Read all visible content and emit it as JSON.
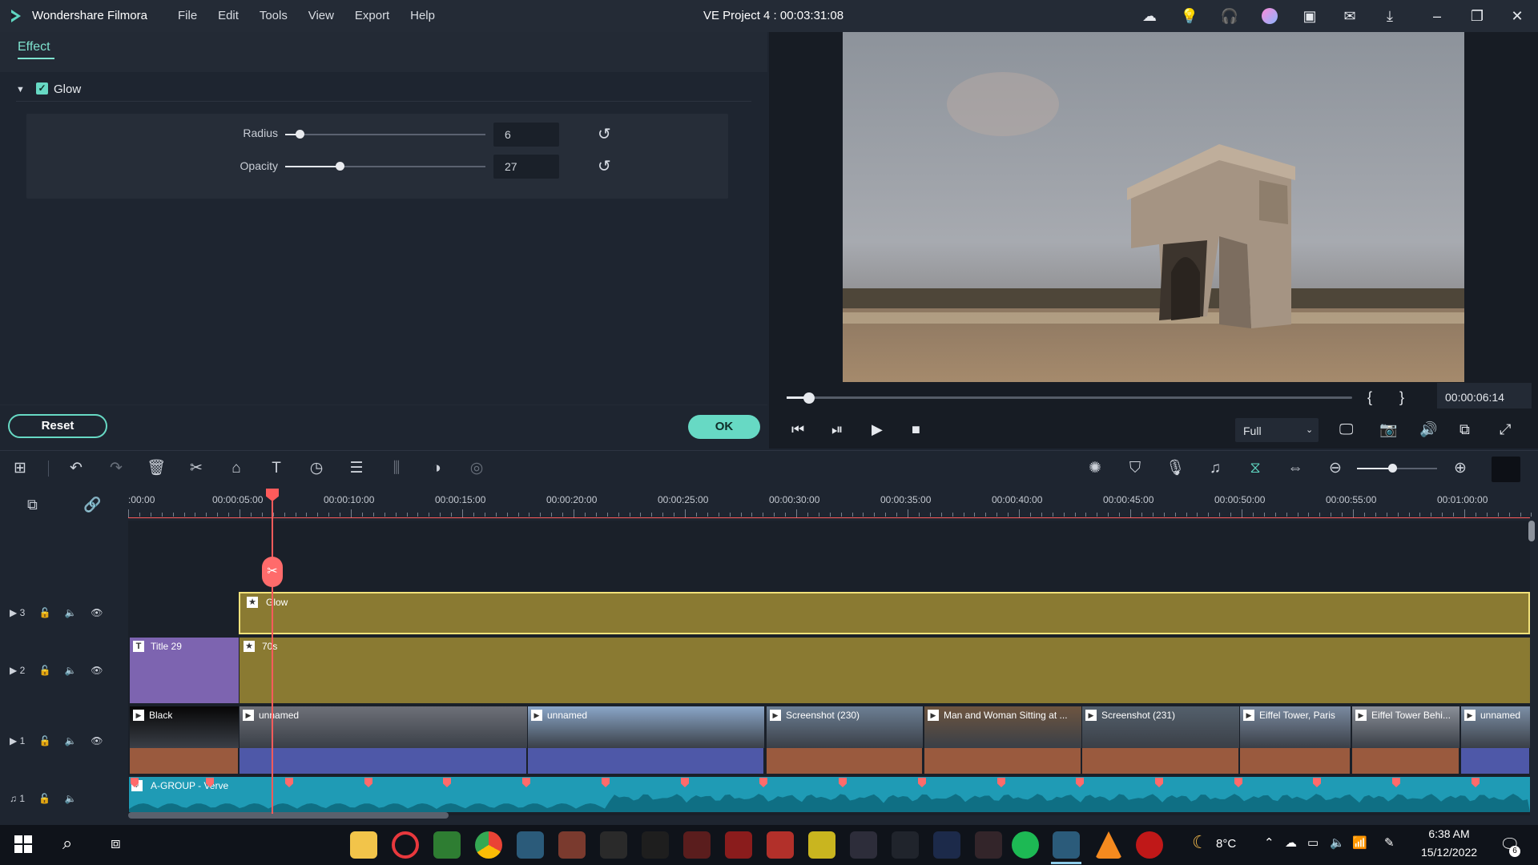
{
  "app": {
    "name": "Wondershare Filmora",
    "menu": [
      "File",
      "Edit",
      "Tools",
      "View",
      "Export",
      "Help"
    ],
    "project_title": "VE Project 4 : 00:03:31:08"
  },
  "effect_panel": {
    "tab": "Effect",
    "section": "Glow",
    "params": [
      {
        "label": "Radius",
        "value": "6",
        "fraction": 0.07
      },
      {
        "label": "Opacity",
        "value": "27",
        "fraction": 0.27
      }
    ],
    "reset_label": "Reset",
    "ok_label": "OK"
  },
  "preview": {
    "progress_fraction": 0.04,
    "mark_in": "{",
    "mark_out": "}",
    "time": "00:00:06:14",
    "quality": "Full"
  },
  "timeline": {
    "ruler": [
      ":00:00",
      "00:00:05:00",
      "00:00:10:00",
      "00:00:15:00",
      "00:00:20:00",
      "00:00:25:00",
      "00:00:30:00",
      "00:00:35:00",
      "00:00:40:00",
      "00:00:45:00",
      "00:00:50:00",
      "00:00:55:00",
      "00:01:00:00"
    ],
    "tracks": [
      {
        "id": "3",
        "type": "video"
      },
      {
        "id": "2",
        "type": "video"
      },
      {
        "id": "1",
        "type": "video"
      },
      {
        "id": "1",
        "type": "audio"
      }
    ],
    "clips": {
      "glow": "Glow",
      "title": "Title 29",
      "effect70s": "70s",
      "video": [
        "Black",
        "unnamed",
        "unnamed",
        "Screenshot (230)",
        "Man and Woman Sitting at ...",
        "Screenshot (231)",
        "Eiffel Tower, Paris",
        "Eiffel Tower Behi...",
        "unnamed"
      ],
      "audio": "A-GROUP - Verve"
    }
  },
  "taskbar": {
    "temperature": "8°C",
    "time": "6:38 AM",
    "date": "15/12/2022",
    "notifications": "6"
  },
  "colors": {
    "accent": "#67d9c4",
    "playhead": "#ff5b5b",
    "effect_clip": "#8a7a32",
    "title_clip": "#7d64b0",
    "audio_clip": "#1f9bb5"
  }
}
